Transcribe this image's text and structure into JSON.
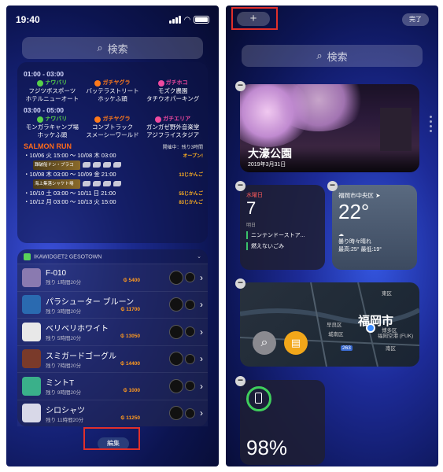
{
  "left": {
    "status": {
      "time": "19:40"
    },
    "search_placeholder": "検索",
    "schedule": {
      "slots": [
        {
          "time": "01:00 - 03:00",
          "rules": [
            {
              "name": "ナワバリ",
              "color": "#58d04a",
              "stages": [
                "フジツボスポーツ",
                "ホテルニューオート"
              ]
            },
            {
              "name": "ガチヤグラ",
              "color": "#ff7a1a",
              "stages": [
                "バッテラストリート",
                "ホッケふ頭"
              ]
            },
            {
              "name": "ガチホコ",
              "color": "#f04aa0",
              "stages": [
                "モズク農園",
                "タチウオパーキング"
              ]
            }
          ]
        },
        {
          "time": "03:00 - 05:00",
          "rules": [
            {
              "name": "ナワバリ",
              "color": "#58d04a",
              "stages": [
                "モンガラキャンプ場",
                "ホッケふ頭"
              ]
            },
            {
              "name": "ガチヤグラ",
              "color": "#ff7a1a",
              "stages": [
                "コンブトラック",
                "スメーシーワールド"
              ]
            },
            {
              "name": "ガチエリア",
              "color": "#f04aa0",
              "stages": [
                "ガンガゼ野外音楽堂",
                "アジフライスタジア"
              ]
            }
          ]
        }
      ],
      "salmon": {
        "title": "SALMON RUN",
        "note": "開催中：残り3時間",
        "rows": [
          {
            "text": "・10/06 火 15:00 ～ 10/08 木 03:00",
            "tag": "オープン!",
            "stage": "難破船ドン・ブラコ"
          },
          {
            "text": "・10/08 木 03:00 ～ 10/09 金 21:00",
            "tag": "13じかんご",
            "stage": "海上集落シャケト場"
          },
          {
            "text": "・10/10 土 03:00 ～ 10/11 日 21:00",
            "tag": "55じかんご",
            "stage": ""
          },
          {
            "text": "・10/12 月 03:00 ～ 10/13 火 15:00",
            "tag": "83じかんご",
            "stage": ""
          }
        ]
      }
    },
    "gesotown": {
      "header": "IKAWIDGET2 GESOTOWN",
      "items": [
        {
          "name": "F-010",
          "remaining": "残り 1時間20分",
          "price": "5400",
          "color": "#8a7ab0"
        },
        {
          "name": "パラシューター ブルーン",
          "remaining": "残り 3時間20分",
          "price": "11700",
          "color": "#2a6ab0"
        },
        {
          "name": "ベリベリホワイト",
          "remaining": "残り 5時間20分",
          "price": "13050",
          "color": "#e8e8e8"
        },
        {
          "name": "スミガードゴーグル",
          "remaining": "残り 7時間20分",
          "price": "14400",
          "color": "#7a3a2a"
        },
        {
          "name": "ミントT",
          "remaining": "残り 9時間20分",
          "price": "1000",
          "color": "#3ab08a"
        },
        {
          "name": "シロシャツ",
          "remaining": "残り 11時間20分",
          "price": "11250",
          "color": "#d8d8e8"
        }
      ]
    },
    "edit_label": "編集"
  },
  "right": {
    "add_label": "+",
    "done_label": "完了",
    "search_placeholder": "検索",
    "photo": {
      "title": "大濠公園",
      "date": "2019年3月31日"
    },
    "calendar": {
      "weekday": "水曜日",
      "day": "7",
      "label": "明日",
      "events": [
        "ニンテンドーストア...",
        "燃えないごみ"
      ]
    },
    "weather": {
      "location": "福岡市中央区",
      "temp": "22°",
      "condition": "曇り時々晴れ",
      "range": "最高:25° 最低:19°"
    },
    "map": {
      "city": "福岡市",
      "labels": [
        "早良区",
        "城南区",
        "東区",
        "南区",
        "博多区",
        "福岡空港 (FUK)"
      ],
      "route": "263"
    },
    "battery": {
      "percent": "98%"
    }
  },
  "colors": {
    "highlight": "#e0302a",
    "battery_green": "#3fcf5c"
  }
}
